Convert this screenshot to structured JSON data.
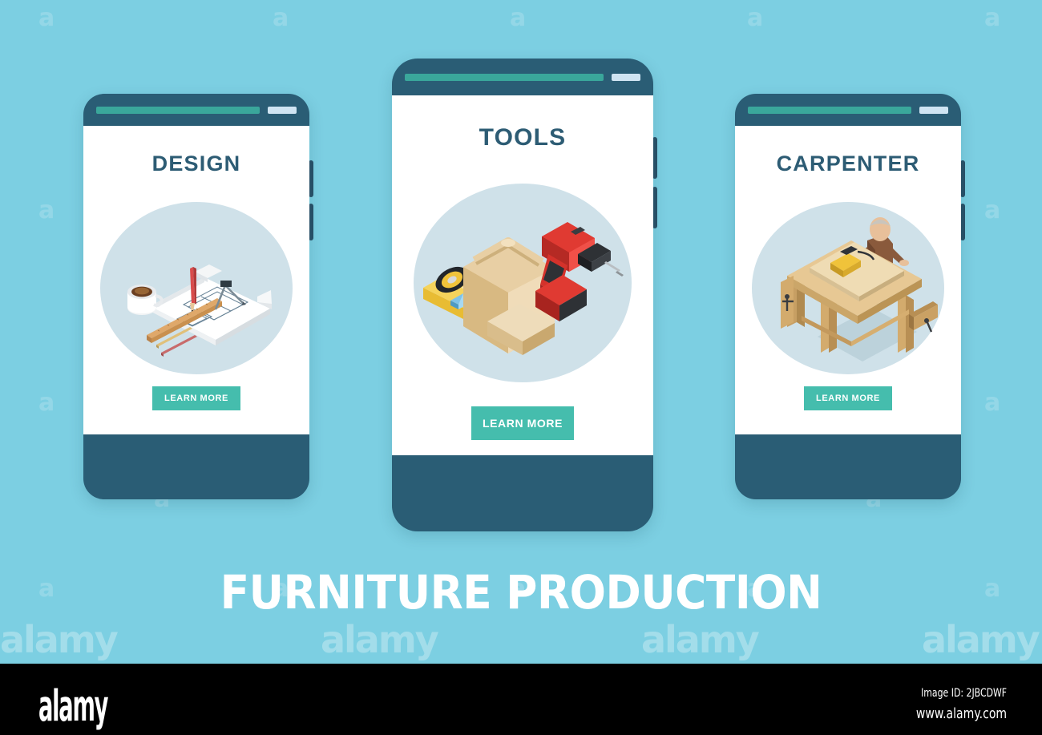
{
  "background_color": "#7ccfe2",
  "headline": "FURNITURE PRODUCTION",
  "theme": {
    "phone_frame": "#2a5d75",
    "screen": "#ffffff",
    "title_color": "#2d5c74",
    "cta_color": "#45bdad",
    "cta_text_color": "#ffffff",
    "address_bar": "#3aa79b",
    "status_chip": "#cfe4f2",
    "art_circle": "#cfe1e9"
  },
  "watermark": {
    "letter": "a",
    "word": "alamy"
  },
  "cards": [
    {
      "id": "design",
      "title": "DESIGN",
      "cta_label": "LEARN MORE",
      "illustration": "blueprint-drafting-icon",
      "illustration_items": [
        "blueprint",
        "coffee-cup",
        "pencil",
        "ruler",
        "compass",
        "colored-pencils"
      ]
    },
    {
      "id": "tools",
      "title": "TOOLS",
      "cta_label": "LEARN MORE",
      "illustration": "toolbox-drill-icon",
      "illustration_items": [
        "wooden-toolbox",
        "cordless-drill",
        "spirit-level",
        "tape-measure"
      ]
    },
    {
      "id": "carpenter",
      "title": "CARPENTER",
      "cta_label": "LEARN MORE",
      "illustration": "carpenter-workbench-icon",
      "illustration_items": [
        "workbench",
        "carpenter-worker",
        "sander",
        "wood-plank",
        "vise"
      ]
    }
  ],
  "footer": {
    "logo": "alamy",
    "image_id": "Image ID: 2JBCDWF",
    "url": "www.alamy.com"
  }
}
